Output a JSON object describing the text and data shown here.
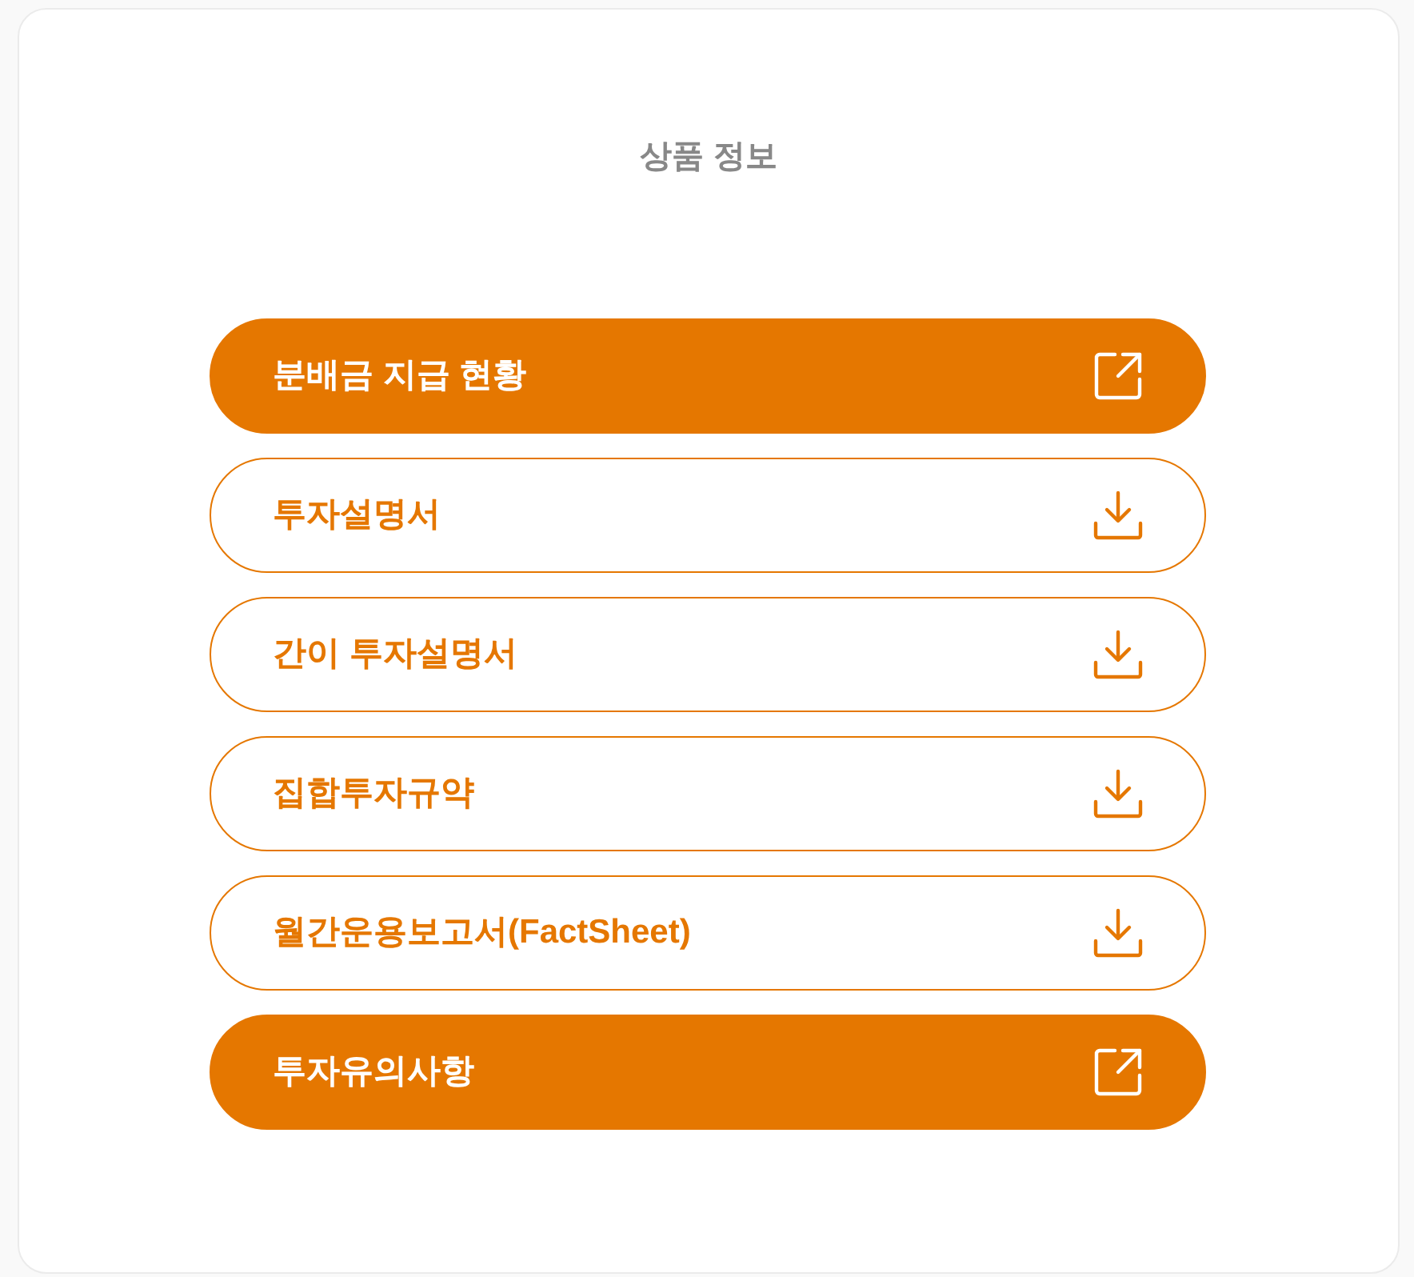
{
  "title": "상품 정보",
  "buttons": [
    {
      "label": "분배금 지급 현황",
      "kind": "external"
    },
    {
      "label": "투자설명서",
      "kind": "download"
    },
    {
      "label": "간이 투자설명서",
      "kind": "download"
    },
    {
      "label": "집합투자규약",
      "kind": "download"
    },
    {
      "label": "월간운용보고서(FactSheet)",
      "kind": "download"
    },
    {
      "label": "투자유의사항",
      "kind": "external"
    }
  ]
}
